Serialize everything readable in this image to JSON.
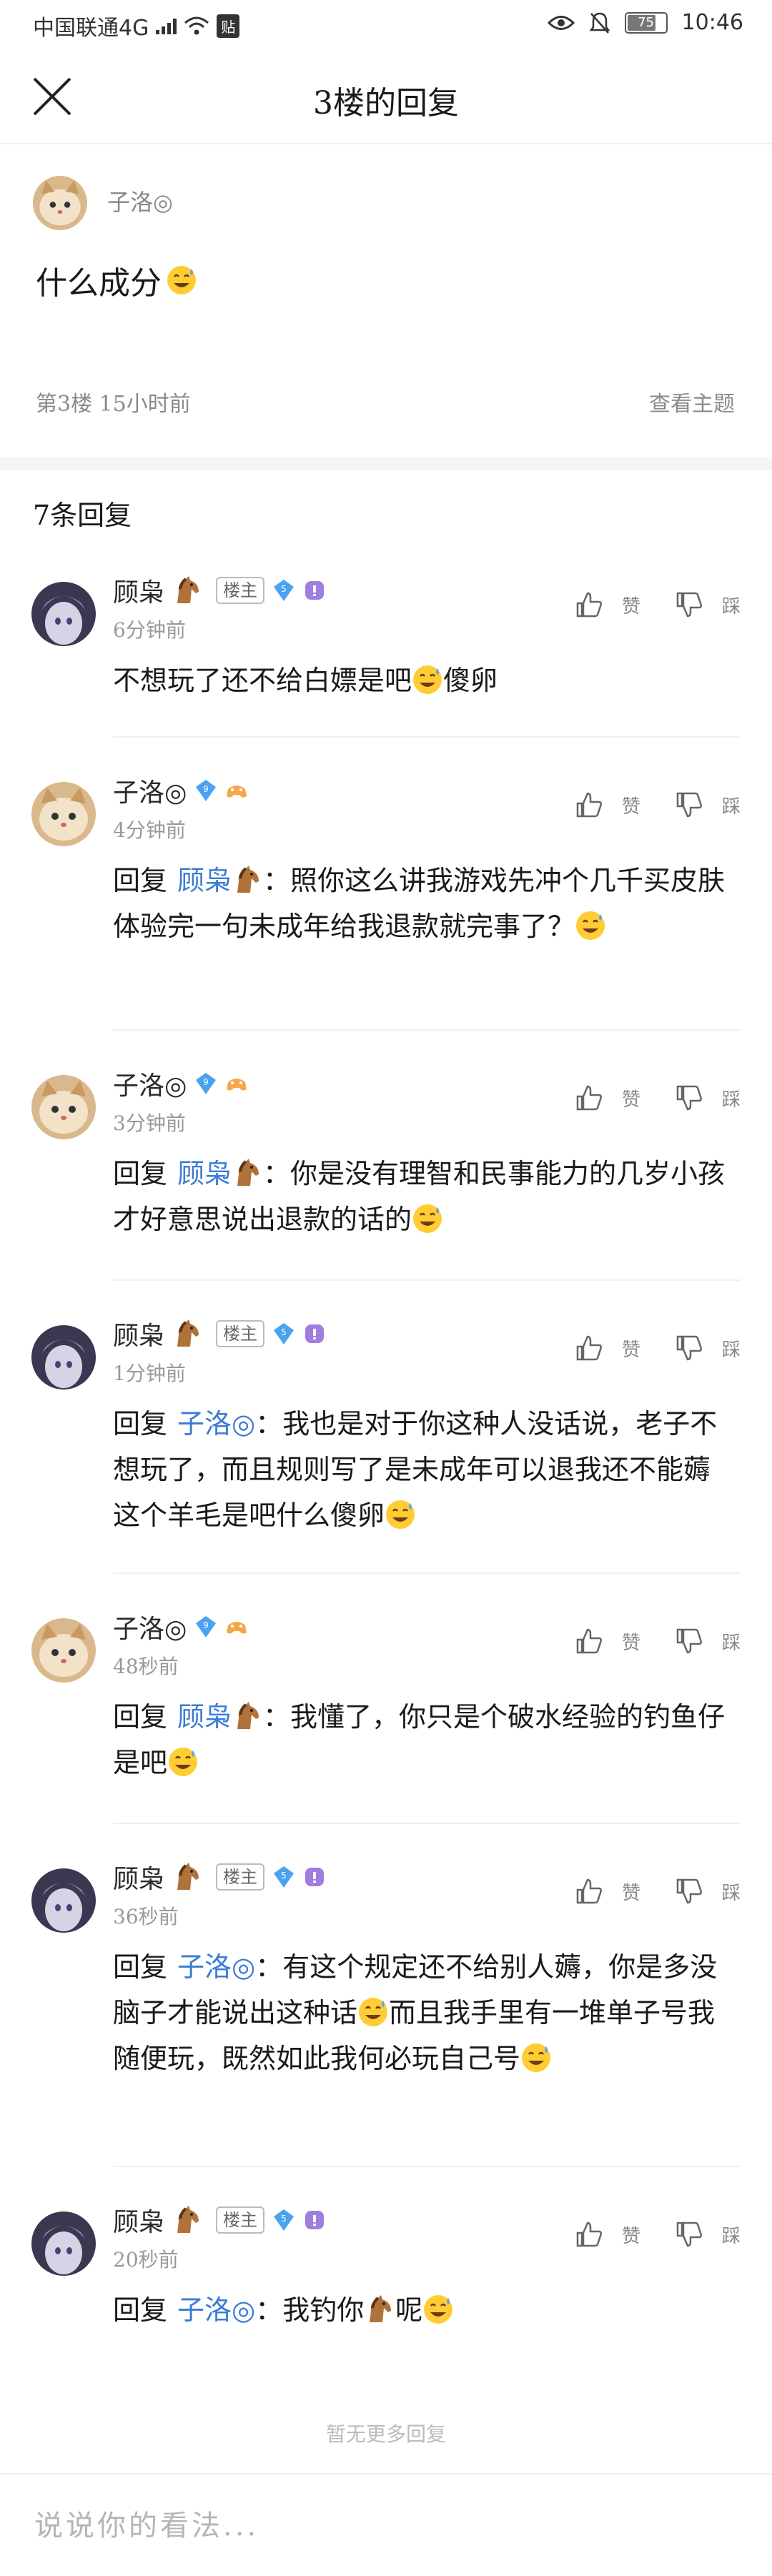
{
  "status_bar": {
    "carrier": "中国联通4G",
    "network": "4G",
    "tie_badge": "贴",
    "battery": "75",
    "time": "10:46"
  },
  "nav": {
    "title": "3楼的回复"
  },
  "post": {
    "username": "子洛◎",
    "content": "什么成分",
    "meta": "第3楼  15小时前",
    "view_topic": "查看主题"
  },
  "reply_count": "7条回复",
  "labels": {
    "owner_tag": "楼主",
    "like": "赞",
    "dislike": "踩",
    "reply_prefix": "回复"
  },
  "replies": [
    {
      "username": "顾枭",
      "is_owner": true,
      "level": "5",
      "time": "6分钟前",
      "reply_to": "",
      "text": "不想玩了还不给白嫖是吧",
      "tail": "傻卵"
    },
    {
      "username": "子洛◎",
      "is_owner": false,
      "level": "9",
      "time": "4分钟前",
      "reply_to": "顾枭",
      "text": "：照你这么讲我游戏先冲个几千买皮肤体验完一句未成年给我退款就完事了？",
      "tail": ""
    },
    {
      "username": "子洛◎",
      "is_owner": false,
      "level": "9",
      "time": "3分钟前",
      "reply_to": "顾枭",
      "text": "：你是没有理智和民事能力的几岁小孩才好意思说出退款的话的",
      "tail": ""
    },
    {
      "username": "顾枭",
      "is_owner": true,
      "level": "5",
      "time": "1分钟前",
      "reply_to": "子洛◎",
      "text": "：我也是对于你这种人没话说，老子不想玩了，而且规则写了是未成年可以退我还不能薅这个羊毛是吧什么傻卵",
      "tail": ""
    },
    {
      "username": "子洛◎",
      "is_owner": false,
      "level": "9",
      "time": "48秒前",
      "reply_to": "顾枭",
      "text": "：我懂了，你只是个破水经验的钓鱼仔是吧",
      "tail": ""
    },
    {
      "username": "顾枭",
      "is_owner": true,
      "level": "5",
      "time": "36秒前",
      "reply_to": "子洛◎",
      "text": "：有这个规定还不给别人薅，你是多没脑子才能说出这种话",
      "tail": "而且我手里有一堆单子号我随便玩，既然如此我何必玩自己号"
    },
    {
      "username": "顾枭",
      "is_owner": true,
      "level": "5",
      "time": "20秒前",
      "reply_to": "子洛◎",
      "text": "：我钓你",
      "tail": "呢"
    }
  ],
  "no_more": "暂无更多回复",
  "input": {
    "placeholder": "说说你的看法..."
  }
}
